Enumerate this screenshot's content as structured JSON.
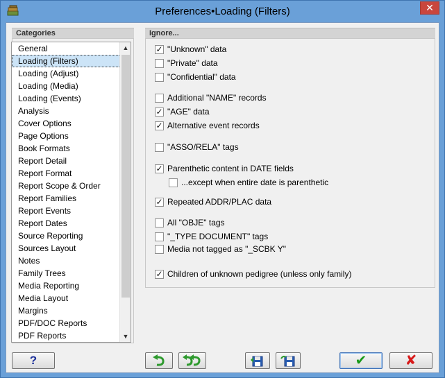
{
  "window": {
    "title": "Preferences•Loading (Filters)",
    "close_label": "✕"
  },
  "categories": {
    "header": "Categories",
    "items": [
      "General",
      "Loading (Filters)",
      "Loading (Adjust)",
      "Loading (Media)",
      "Loading (Events)",
      "Analysis",
      "Cover Options",
      "Page Options",
      "Book Formats",
      "Report Detail",
      "Report Format",
      "Report Scope & Order",
      "Report Families",
      "Report Events",
      "Report Dates",
      "Source Reporting",
      "Sources Layout",
      "Notes",
      "Family Trees",
      "Media Reporting",
      "Media Layout",
      "Margins",
      "PDF/DOC Reports",
      "PDF Reports"
    ],
    "selected": "Loading (Filters)"
  },
  "ignore": {
    "header": "Ignore...",
    "options": [
      {
        "label": "\"Unknown\" data",
        "checked": true
      },
      {
        "label": "\"Private\" data",
        "checked": false
      },
      {
        "label": "\"Confidential\" data",
        "checked": false
      },
      {
        "label": "Additional \"NAME\" records",
        "checked": false
      },
      {
        "label": "\"AGE\" data",
        "checked": true
      },
      {
        "label": "Alternative event records",
        "checked": true
      },
      {
        "label": "\"ASSO/RELA\" tags",
        "checked": false
      },
      {
        "label": "Parenthetic content in DATE fields",
        "checked": true
      },
      {
        "label": "...except when entire date is parenthetic",
        "checked": false
      },
      {
        "label": "Repeated ADDR/PLAC data",
        "checked": true
      },
      {
        "label": "All \"OBJE\" tags",
        "checked": false
      },
      {
        "label": "\"_TYPE DOCUMENT\" tags",
        "checked": false
      },
      {
        "label": "Media not tagged as \"_SCBK Y\"",
        "checked": false
      },
      {
        "label": "Children of unknown pedigree (unless only family)",
        "checked": true
      }
    ]
  },
  "buttons": {
    "help": "?",
    "undo_icon": "undo-icon",
    "redo_icon": "redo-all-icon",
    "save_icon": "save-icon",
    "load_icon": "load-icon",
    "ok_icon": "check-icon",
    "cancel_icon": "cross-icon"
  },
  "colors": {
    "ok": "#1a9a1a",
    "cancel": "#d81b1b",
    "undo_arrow": "#2e9a2e"
  }
}
